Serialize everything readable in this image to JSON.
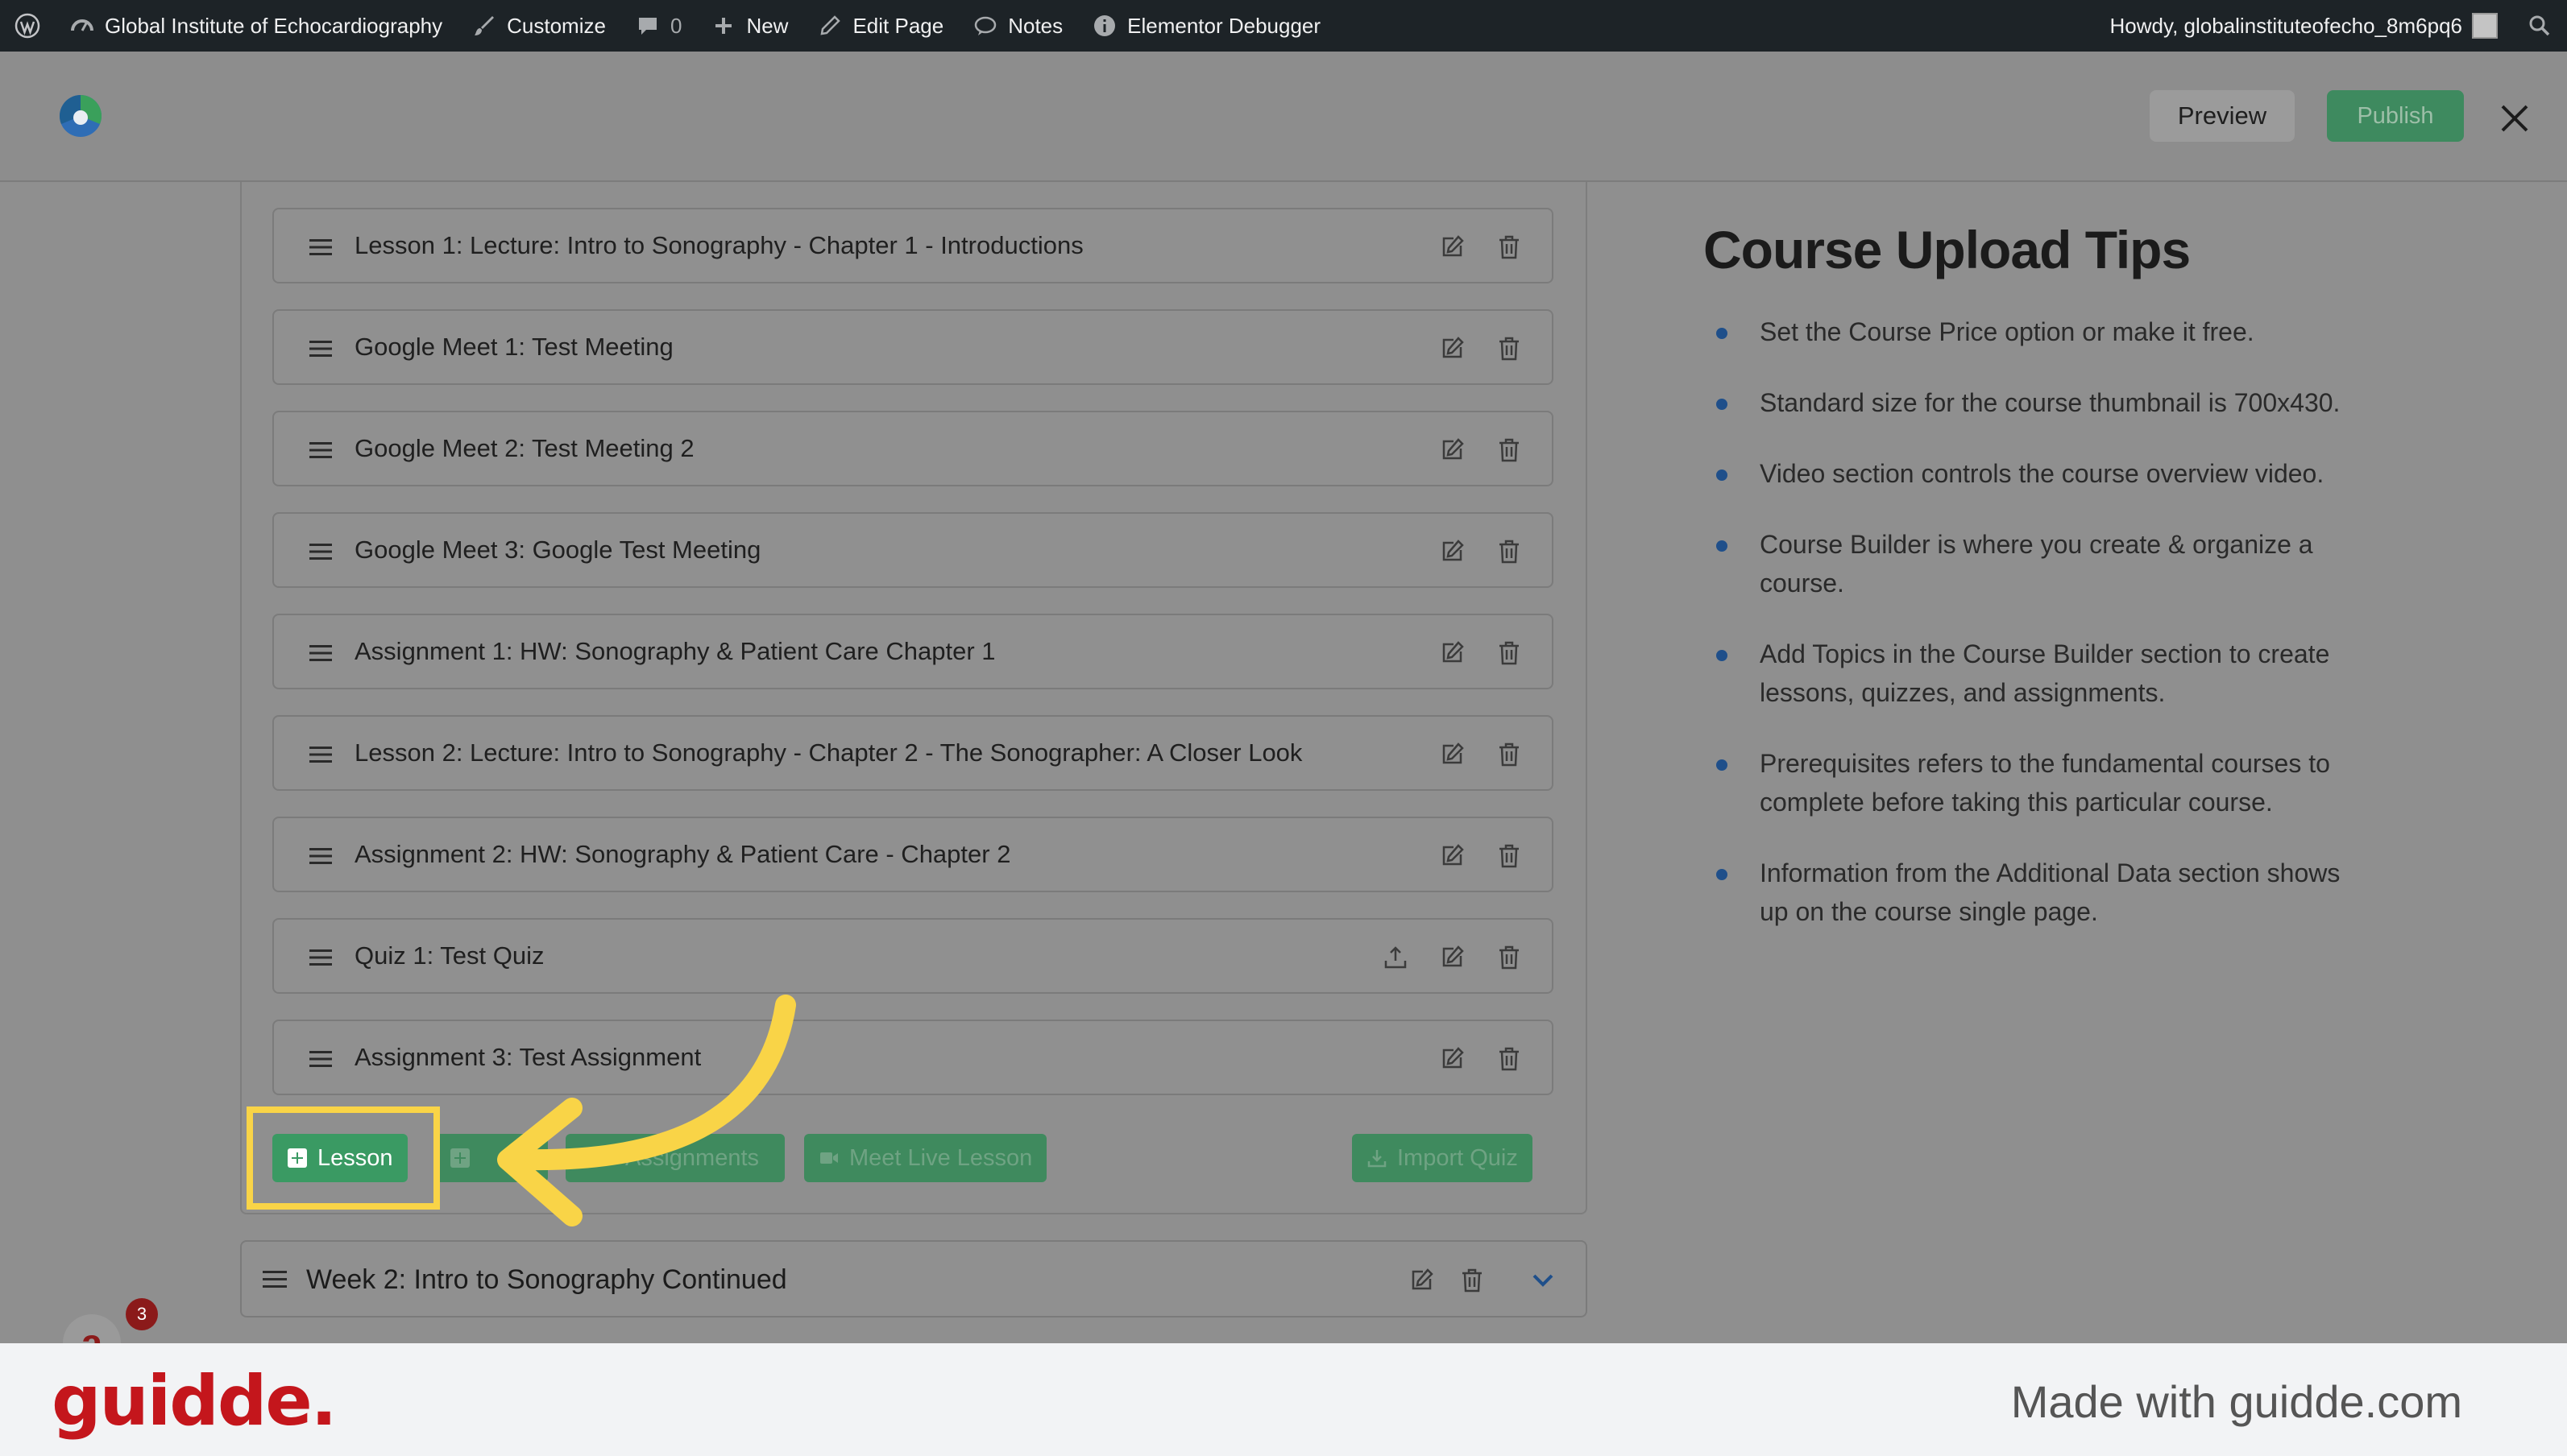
{
  "adminbar": {
    "site_name": "Global Institute of Echocardiography",
    "customize": "Customize",
    "comments_count": "0",
    "new": "New",
    "edit_page": "Edit Page",
    "notes": "Notes",
    "debugger": "Elementor Debugger",
    "howdy": "Howdy, globalinstituteofecho_8m6pq6"
  },
  "header": {
    "preview_label": "Preview",
    "publish_label": "Publish"
  },
  "topic_items": [
    {
      "title": "Lesson 1: Lecture: Intro to Sonography - Chapter 1 - Introductions"
    },
    {
      "title": "Google Meet 1: Test Meeting"
    },
    {
      "title": "Google Meet 2: Test Meeting 2"
    },
    {
      "title": "Google Meet 3: Google Test Meeting"
    },
    {
      "title": "Assignment 1: HW: Sonography & Patient Care Chapter 1"
    },
    {
      "title": "Lesson 2: Lecture: Intro to Sonography - Chapter 2 - The Sonographer: A Closer Look"
    },
    {
      "title": "Assignment 2: HW: Sonography & Patient Care - Chapter 2"
    },
    {
      "title": "Quiz 1: Test Quiz"
    },
    {
      "title": "Assignment 3: Test Assignment"
    }
  ],
  "actions": {
    "lesson": "Lesson",
    "assignments": "Assignments",
    "meet_live": "Meet Live Lesson",
    "import_quiz": "Import Quiz"
  },
  "week2": {
    "title": "Week 2: Intro to Sonography Continued"
  },
  "tips": {
    "title": "Course Upload Tips",
    "items": [
      "Set the Course Price option or make it free.",
      "Standard size for the course thumbnail is 700x430.",
      "Video section controls the course overview video.",
      "Course Builder is where you create & organize a course.",
      "Add Topics in the Course Builder section to create lessons, quizzes, and assignments.",
      "Prerequisites refers to the fundamental courses to complete before taking this particular course.",
      "Information from the Additional Data section shows up on the course single page."
    ]
  },
  "bubble": {
    "count": "3"
  },
  "footer": {
    "brand": "guidde.",
    "made_with": "Made with guidde.com"
  },
  "colors": {
    "accent_green": "#3a9a63",
    "highlight_yellow": "#f9d447",
    "brand_red": "#c4161c"
  }
}
